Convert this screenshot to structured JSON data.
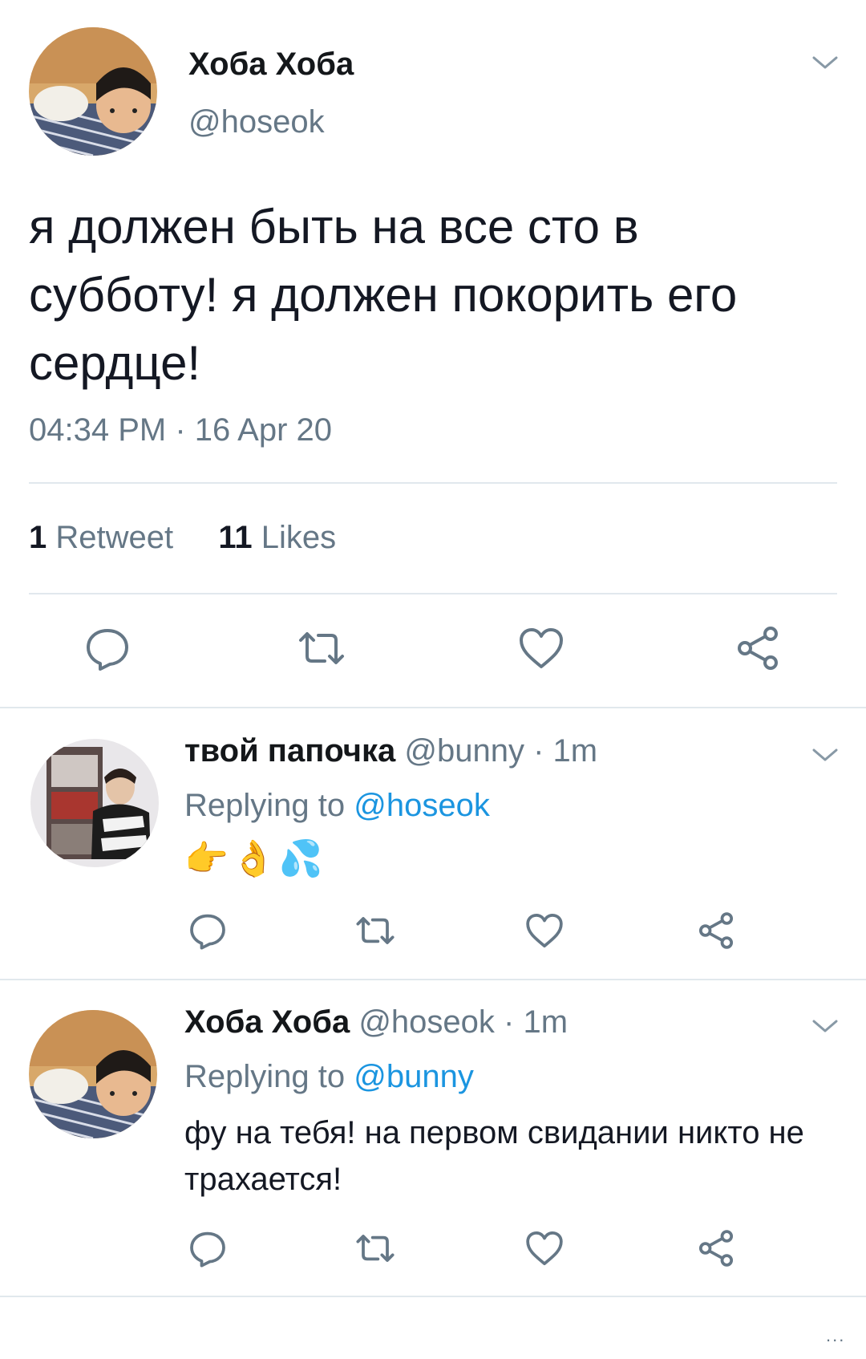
{
  "main_tweet": {
    "name": "Хоба Хоба",
    "handle": "@hoseok",
    "text": "я должен быть на все сто в субботу! я должен покорить его сердце!",
    "timestamp": "04:34 PM · 16 Apr 20",
    "retweet_count": "1",
    "retweet_label": "Retweet",
    "likes_count": "11",
    "likes_label": "Likes"
  },
  "replies": [
    {
      "name": "твой папочка",
      "handle": "@bunny",
      "time": "· 1m",
      "replying_prefix": "Replying to",
      "replying_to": "@hoseok",
      "text": "👉👌💦"
    },
    {
      "name": "Хоба Хоба",
      "handle": "@hoseok",
      "time": "· 1m",
      "replying_prefix": "Replying to",
      "replying_to": "@bunny",
      "text": "фу на тебя! на первом свидании никто не трахается!"
    }
  ],
  "overflow_indicator": "...",
  "colors": {
    "text": "#14171a",
    "secondary": "#657786",
    "link": "#1b95e0",
    "divider": "#e1e8ed"
  },
  "icons": [
    "reply-icon",
    "retweet-icon",
    "like-icon",
    "share-icon",
    "chevron-down-icon"
  ]
}
